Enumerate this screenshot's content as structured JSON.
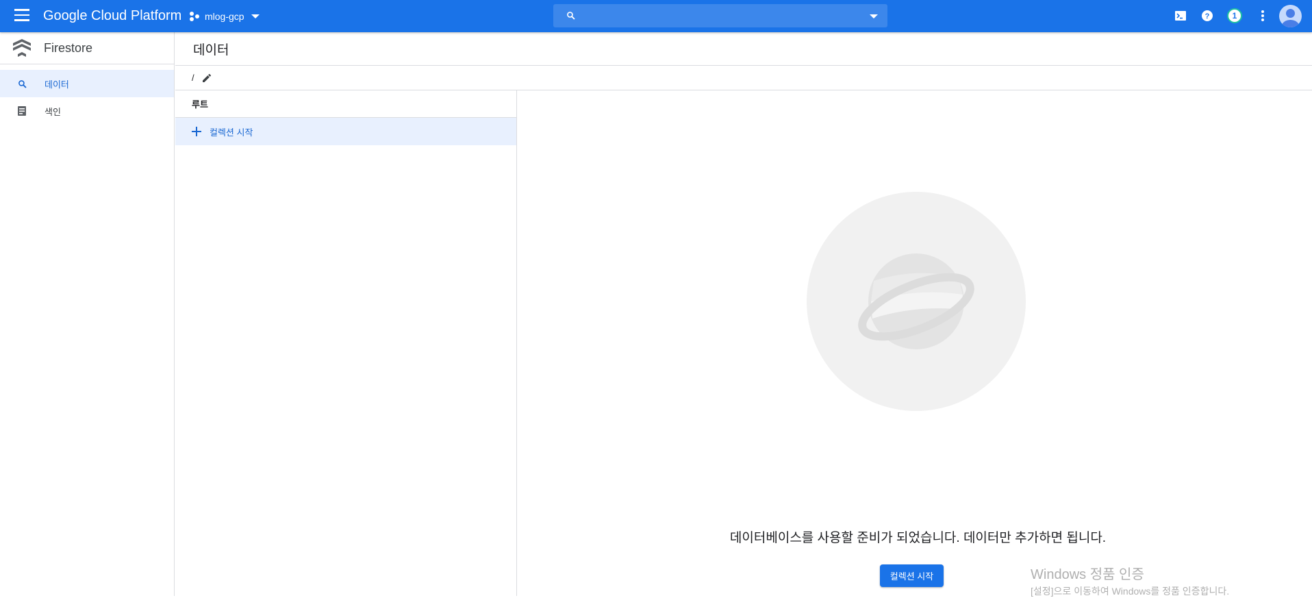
{
  "topbar": {
    "menu_icon": "hamburger-menu-icon",
    "brand": "Google Cloud Platform",
    "project_name": "mlog-gcp",
    "search_placeholder": "",
    "notification_count": "1",
    "colors": {
      "bar": "#1a73e8",
      "badge_ring": "#1ec1a3"
    }
  },
  "sidebar": {
    "product_title": "Firestore",
    "items": [
      {
        "label": "데이터",
        "icon": "search-icon",
        "active": true
      },
      {
        "label": "색인",
        "icon": "index-icon",
        "active": false
      }
    ]
  },
  "main": {
    "page_title": "데이터",
    "path": "/",
    "root_header": "루트",
    "add_collection_label": "컬렉션 시작",
    "empty_message": "데이터베이스를 사용할 준비가 되었습니다. 데이터만 추가하면 됩니다.",
    "start_collection_button": "컬렉션 시작"
  },
  "watermark": {
    "line1": "Windows 정품 인증",
    "line2": "[설정]으로 이동하여 Windows를 정품 인증합니다."
  }
}
